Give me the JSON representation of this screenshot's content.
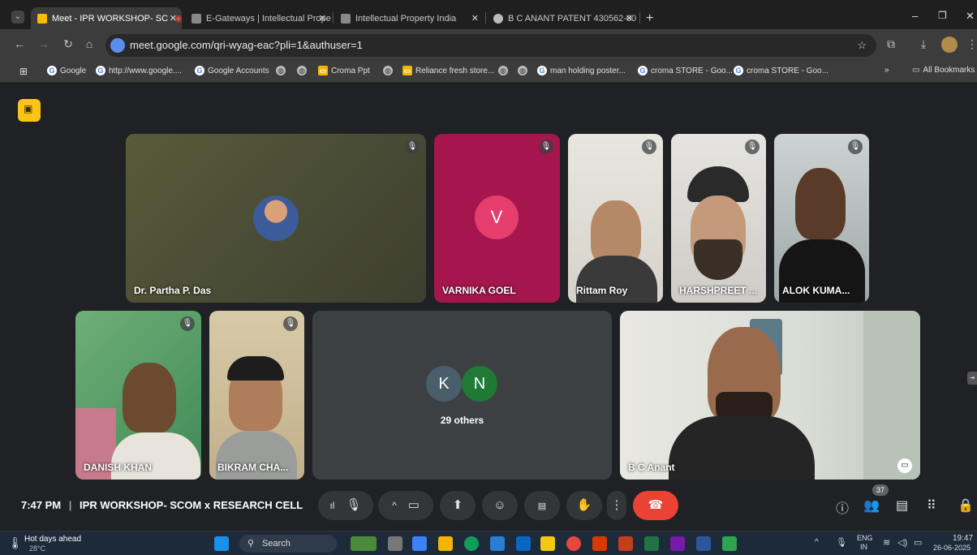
{
  "browser": {
    "tabs": [
      {
        "title": "Meet - IPR WORKSHOP- SC",
        "active": true,
        "color": "#fbbc04"
      },
      {
        "title": "E-Gateways | Intellectual Prope",
        "active": false,
        "color": "#888888"
      },
      {
        "title": "Intellectual Property India",
        "active": false,
        "color": "#888888"
      },
      {
        "title": "B C ANANT PATENT 430562-00",
        "active": false,
        "color": "#bbbbbb"
      }
    ],
    "new_tab": "+",
    "url": "meet.google.com/qri-wyag-eac?pli=1&authuser=1",
    "bookmarks": [
      {
        "label": "Google",
        "icon": "google"
      },
      {
        "label": "http://www.google....",
        "icon": "google"
      },
      {
        "label": "Google Accounts",
        "icon": "google"
      },
      {
        "label": "",
        "icon": "globe"
      },
      {
        "label": "",
        "icon": "globe"
      },
      {
        "label": "Croma Ppt",
        "icon": "slides"
      },
      {
        "label": "",
        "icon": "globe"
      },
      {
        "label": "Reliance fresh store...",
        "icon": "slides"
      },
      {
        "label": "",
        "icon": "globe"
      },
      {
        "label": "",
        "icon": "globe"
      },
      {
        "label": "man holding poster...",
        "icon": "google"
      },
      {
        "label": "croma STORE - Goo...",
        "icon": "google"
      },
      {
        "label": "croma STORE - Goo...",
        "icon": "google"
      }
    ],
    "more_bookmarks": "»",
    "all_bookmarks": "All Bookmarks"
  },
  "meeting": {
    "participants_top": [
      {
        "name": "Dr. Partha P. Das",
        "muted": true
      },
      {
        "name": "VARNIKA GOEL",
        "muted": true,
        "initial": "V"
      },
      {
        "name": "Rittam Roy",
        "muted": true
      },
      {
        "name": "HARSHPREET ...",
        "muted": true
      },
      {
        "name": "ALOK KUMA...",
        "muted": true
      }
    ],
    "participants_bottom": [
      {
        "name": "DANISH KHAN",
        "muted": true
      },
      {
        "name": "BIKRAM CHA...",
        "muted": true
      },
      {
        "name": "B C Anant",
        "muted": false
      }
    ],
    "others": {
      "initials": [
        "K",
        "N"
      ],
      "label": "29 others"
    },
    "time": "7:47 PM",
    "separator": "|",
    "title": "IPR WORKSHOP- SCOM x RESEARCH CELL",
    "people_count": "37"
  },
  "taskbar": {
    "weather_title": "Hot days ahead",
    "weather_temp": "28°C",
    "search_placeholder": "Search",
    "lang": "ENG",
    "region": "IN",
    "clock_time": "19:47",
    "clock_date": "26-06-2025"
  },
  "colors": {
    "meet_bg": "#202124",
    "end_call": "#ea4335",
    "varnika_tile": "#a5164e",
    "varnika_avatar": "#e53e6c",
    "avatar_k": "#4a5d6b",
    "avatar_n": "#1e7a34"
  }
}
